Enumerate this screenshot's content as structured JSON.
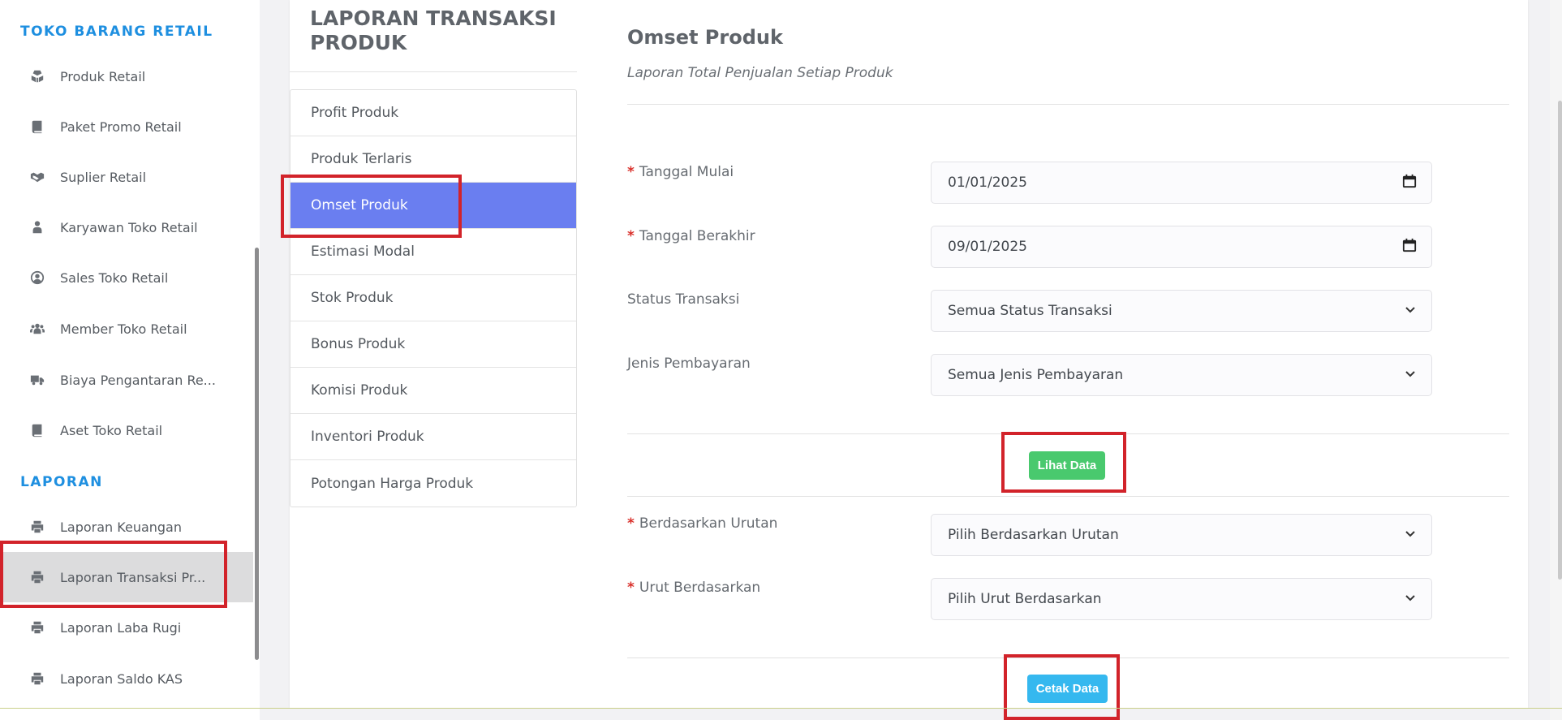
{
  "sidebar": {
    "sections": [
      {
        "title": "TOKO BARANG RETAIL"
      },
      {
        "title": "LAPORAN"
      }
    ],
    "items": [
      {
        "label": "Produk Retail",
        "icon": "cubes-icon"
      },
      {
        "label": "Paket Promo Retail",
        "icon": "book-icon"
      },
      {
        "label": "Suplier Retail",
        "icon": "handshake-icon"
      },
      {
        "label": "Karyawan Toko Retail",
        "icon": "user-tie-icon"
      },
      {
        "label": "Sales Toko Retail",
        "icon": "user-circle-icon"
      },
      {
        "label": "Member Toko Retail",
        "icon": "users-icon"
      },
      {
        "label": "Biaya Pengantaran Re...",
        "icon": "truck-icon"
      },
      {
        "label": "Aset Toko Retail",
        "icon": "book-icon"
      },
      {
        "label": "Laporan Keuangan",
        "icon": "print-icon"
      },
      {
        "label": "Laporan Transaksi Pr...",
        "icon": "print-icon",
        "active": true
      },
      {
        "label": "Laporan Laba Rugi",
        "icon": "print-icon"
      },
      {
        "label": "Laporan Saldo KAS",
        "icon": "print-icon"
      }
    ]
  },
  "report_menu": {
    "title": "LAPORAN TRANSAKSI PRODUK",
    "items": [
      {
        "label": "Profit Produk"
      },
      {
        "label": "Produk Terlaris"
      },
      {
        "label": "Omset Produk",
        "active": true
      },
      {
        "label": "Estimasi Modal"
      },
      {
        "label": "Stok Produk"
      },
      {
        "label": "Bonus Produk"
      },
      {
        "label": "Komisi Produk"
      },
      {
        "label": "Inventori Produk"
      },
      {
        "label": "Potongan Harga Produk"
      }
    ]
  },
  "form": {
    "title": "Omset Produk",
    "subtitle": "Laporan Total Penjualan Setiap Produk",
    "fields": [
      {
        "label": "Tanggal Mulai",
        "required": "*",
        "value": "01/01/2025",
        "kind": "date"
      },
      {
        "label": "Tanggal Berakhir",
        "required": "*",
        "value": "09/01/2025",
        "kind": "date"
      },
      {
        "label": "Status Transaksi",
        "required": "",
        "value": "Semua Status Transaksi",
        "kind": "select"
      },
      {
        "label": "Jenis Pembayaran",
        "required": "",
        "value": "Semua Jenis Pembayaran",
        "kind": "select"
      },
      {
        "label": "Berdasarkan Urutan",
        "required": "*",
        "value": "Pilih Berdasarkan Urutan",
        "kind": "select"
      },
      {
        "label": "Urut Berdasarkan",
        "required": "*",
        "value": "Pilih Urut Berdasarkan",
        "kind": "select"
      }
    ],
    "view_button": "Lihat Data",
    "print_button": "Cetak Data"
  },
  "colors": {
    "sidebar_section": "#1e8fe0",
    "menu_active": "#6a7ef0",
    "btn_view": "#49c96e",
    "btn_print": "#35b8ef",
    "required": "#d9302b",
    "annotation": "#d2232a"
  }
}
